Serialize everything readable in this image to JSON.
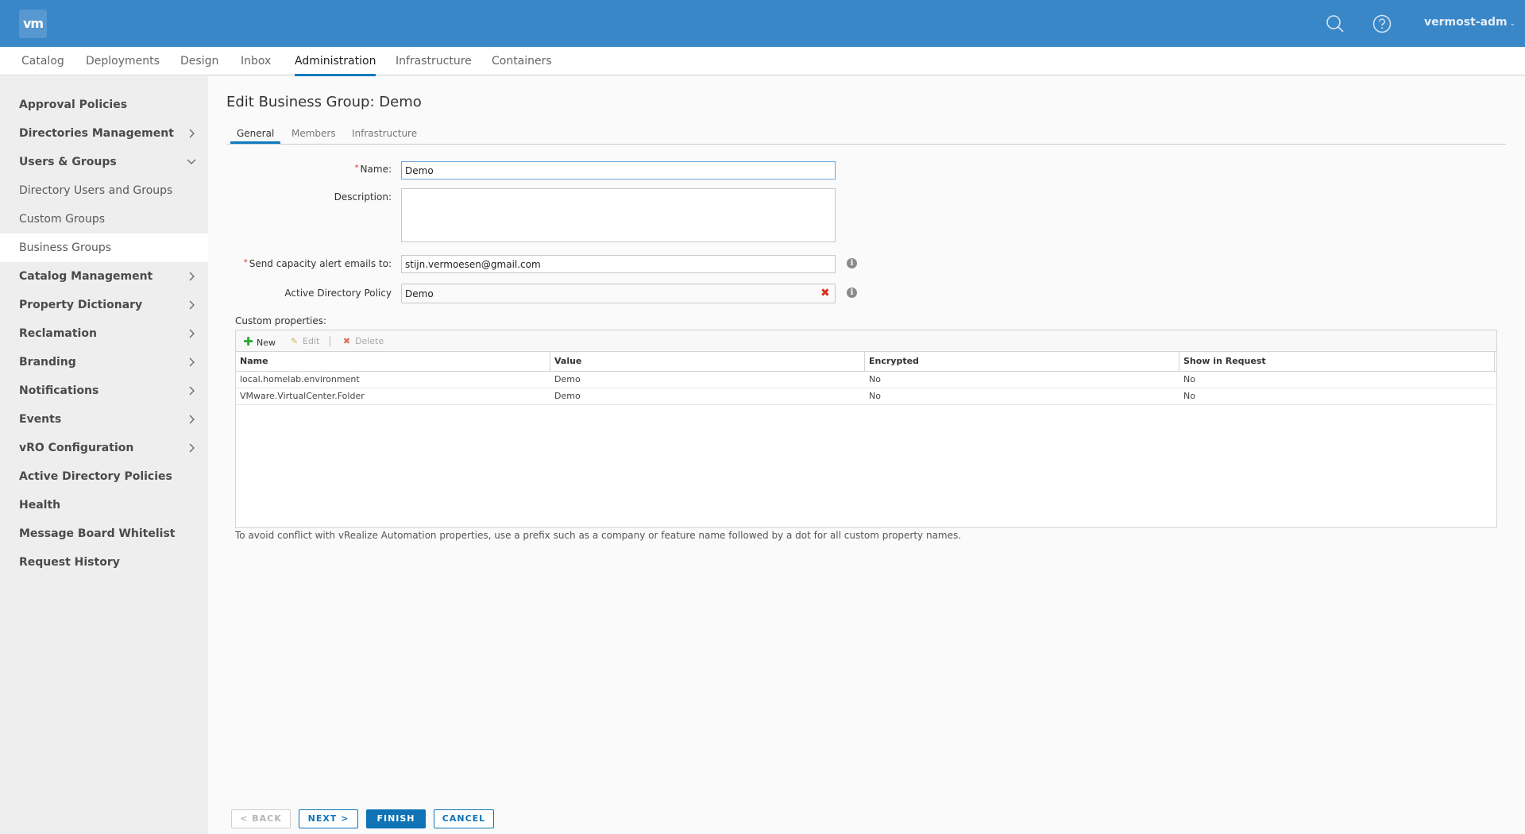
{
  "header": {
    "logo": "vm",
    "search_icon": "search-icon",
    "help_icon": "help-icon",
    "user": "vermost-adm"
  },
  "nav": {
    "items": [
      {
        "label": "Catalog"
      },
      {
        "label": "Deployments"
      },
      {
        "label": "Design"
      },
      {
        "label": "Inbox"
      },
      {
        "label": "Administration",
        "active": true
      },
      {
        "label": "Infrastructure"
      },
      {
        "label": "Containers"
      }
    ]
  },
  "sidebar": {
    "items": [
      {
        "label": "Approval Policies",
        "type": "bold"
      },
      {
        "label": "Directories Management",
        "type": "bold",
        "chevron": "right"
      },
      {
        "label": "Users & Groups",
        "type": "bold",
        "chevron": "down"
      },
      {
        "label": "Directory Users and Groups",
        "type": "sub"
      },
      {
        "label": "Custom Groups",
        "type": "sub"
      },
      {
        "label": "Business Groups",
        "type": "sub",
        "active": true
      },
      {
        "label": "Catalog Management",
        "type": "bold",
        "chevron": "right"
      },
      {
        "label": "Property Dictionary",
        "type": "bold",
        "chevron": "right"
      },
      {
        "label": "Reclamation",
        "type": "bold",
        "chevron": "right"
      },
      {
        "label": "Branding",
        "type": "bold",
        "chevron": "right"
      },
      {
        "label": "Notifications",
        "type": "bold",
        "chevron": "right"
      },
      {
        "label": "Events",
        "type": "bold",
        "chevron": "right"
      },
      {
        "label": "vRO Configuration",
        "type": "bold",
        "chevron": "right"
      },
      {
        "label": "Active Directory Policies",
        "type": "bold"
      },
      {
        "label": "Health",
        "type": "bold"
      },
      {
        "label": "Message Board Whitelist",
        "type": "bold"
      },
      {
        "label": "Request History",
        "type": "bold"
      }
    ]
  },
  "page": {
    "title": "Edit Business Group: Demo",
    "tabs": [
      {
        "label": "General",
        "active": true
      },
      {
        "label": "Members"
      },
      {
        "label": "Infrastructure"
      }
    ]
  },
  "form": {
    "name_label": "Name:",
    "name_value": "Demo",
    "description_label": "Description:",
    "description_value": "",
    "email_label": "Send capacity alert emails to:",
    "email_value": "stijn.vermoesen@gmail.com",
    "ad_policy_label": "Active Directory Policy",
    "ad_policy_value": "Demo",
    "required_marker": "*",
    "info_glyph": "i",
    "clear_glyph": "✖"
  },
  "custom_properties": {
    "label": "Custom properties:",
    "toolbar": {
      "new": "New",
      "edit": "Edit",
      "delete": "Delete"
    },
    "columns": [
      "Name",
      "Value",
      "Encrypted",
      "Show in Request"
    ],
    "rows": [
      [
        "local.homelab.environment",
        "Demo",
        "No",
        "No"
      ],
      [
        "VMware.VirtualCenter.Folder",
        "Demo",
        "No",
        "No"
      ]
    ],
    "footnote": "To avoid conflict with vRealize Automation properties, use a prefix such as a company or feature name followed by a dot for all custom property names."
  },
  "buttons": {
    "back": "< BACK",
    "next": "NEXT >",
    "finish": "FINISH",
    "cancel": "CANCEL"
  },
  "colors": {
    "header_bg": "#3a87c8",
    "accent": "#0f7ac0",
    "primary_button": "#0f73b5",
    "required": "#d9321d",
    "new_icon": "#2ea836",
    "delete_icon": "#d9301f"
  }
}
